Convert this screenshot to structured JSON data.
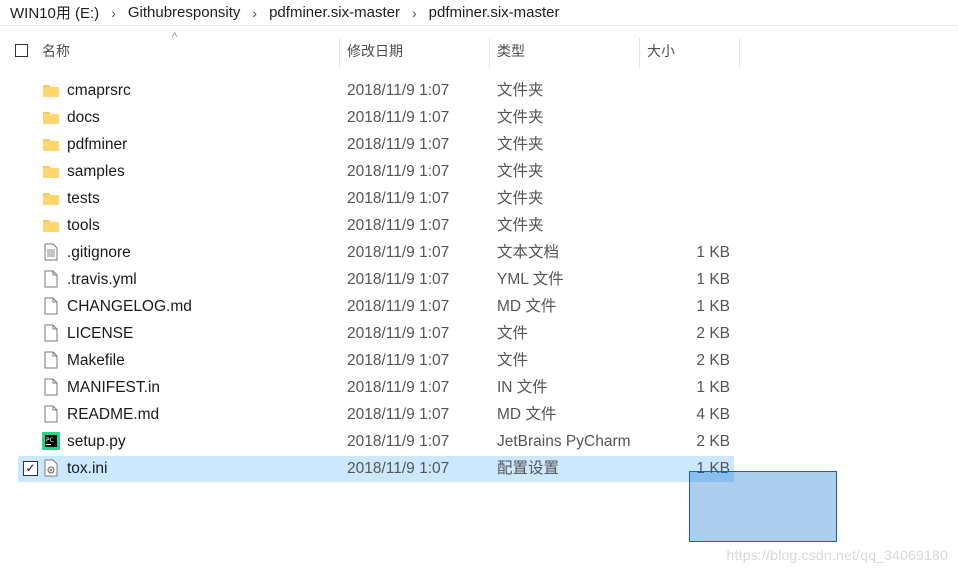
{
  "breadcrumb": [
    "WIN10用 (E:)",
    "Githubresponsity",
    "pdfminer.six-master",
    "pdfminer.six-master"
  ],
  "columns": {
    "name": "名称",
    "date": "修改日期",
    "type": "类型",
    "size": "大小"
  },
  "rows": [
    {
      "name": "cmaprsrc",
      "date": "2018/11/9 1:07",
      "type": "文件夹",
      "size": "",
      "icon": "folder-icon"
    },
    {
      "name": "docs",
      "date": "2018/11/9 1:07",
      "type": "文件夹",
      "size": "",
      "icon": "folder-icon"
    },
    {
      "name": "pdfminer",
      "date": "2018/11/9 1:07",
      "type": "文件夹",
      "size": "",
      "icon": "folder-icon"
    },
    {
      "name": "samples",
      "date": "2018/11/9 1:07",
      "type": "文件夹",
      "size": "",
      "icon": "folder-icon"
    },
    {
      "name": "tests",
      "date": "2018/11/9 1:07",
      "type": "文件夹",
      "size": "",
      "icon": "folder-icon"
    },
    {
      "name": "tools",
      "date": "2018/11/9 1:07",
      "type": "文件夹",
      "size": "",
      "icon": "folder-icon"
    },
    {
      "name": ".gitignore",
      "date": "2018/11/9 1:07",
      "type": "文本文档",
      "size": "1 KB",
      "icon": "text-file-icon"
    },
    {
      "name": ".travis.yml",
      "date": "2018/11/9 1:07",
      "type": "YML 文件",
      "size": "1 KB",
      "icon": "file-icon"
    },
    {
      "name": "CHANGELOG.md",
      "date": "2018/11/9 1:07",
      "type": "MD 文件",
      "size": "1 KB",
      "icon": "file-icon"
    },
    {
      "name": "LICENSE",
      "date": "2018/11/9 1:07",
      "type": "文件",
      "size": "2 KB",
      "icon": "file-icon"
    },
    {
      "name": "Makefile",
      "date": "2018/11/9 1:07",
      "type": "文件",
      "size": "2 KB",
      "icon": "file-icon"
    },
    {
      "name": "MANIFEST.in",
      "date": "2018/11/9 1:07",
      "type": "IN 文件",
      "size": "1 KB",
      "icon": "file-icon"
    },
    {
      "name": "README.md",
      "date": "2018/11/9 1:07",
      "type": "MD 文件",
      "size": "4 KB",
      "icon": "file-icon"
    },
    {
      "name": "setup.py",
      "date": "2018/11/9 1:07",
      "type": "JetBrains PyCharm",
      "size": "2 KB",
      "icon": "pycharm-icon"
    },
    {
      "name": "tox.ini",
      "date": "2018/11/9 1:07",
      "type": "配置设置",
      "size": "1 KB",
      "icon": "settings-file-icon",
      "selected": true
    }
  ],
  "watermark": "https://blog.csdn.net/qq_34069180"
}
